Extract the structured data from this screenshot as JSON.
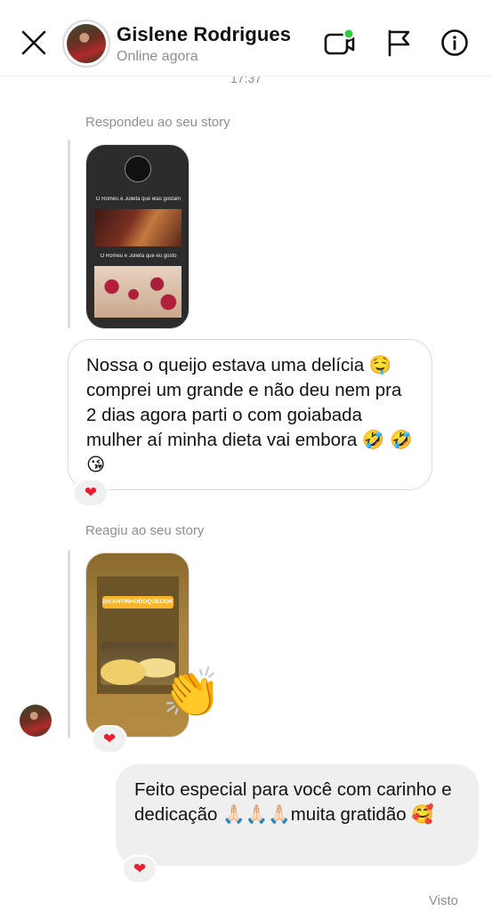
{
  "header": {
    "contact_name": "Gislene Rodrigues",
    "status": "Online agora",
    "close_icon": "close-icon",
    "video_icon": "video-call-icon",
    "flag_icon": "flag-icon",
    "info_icon": "info-icon",
    "online_dot_color": "#2ecc40"
  },
  "time_stamp": "17:37",
  "messages": [
    {
      "type": "story_reply",
      "label": "Respondeu ao seu story",
      "story": {
        "caption_1": "O Romeu e Julieta que elas gostam",
        "caption_2": "O Romeu e Julieta que eu gosto"
      },
      "text": "Nossa o queijo estava uma delícia 🤤 comprei um grande e não deu nem pra 2 dias agora parti o com goiabada mulher aí minha dieta vai embora 🤣 🤣😘",
      "reaction": "❤"
    },
    {
      "type": "story_reaction",
      "label": "Reagiu ao seu story",
      "story": {
        "handle": "@CANTINHODOQUEIJOKE"
      },
      "reaction_emoji": "👏",
      "reaction": "❤"
    },
    {
      "type": "outgoing",
      "text": "Feito especial para você com carinho e dedicação 🙏🏻🙏🏻🙏🏻muita gratidão 🥰",
      "reaction": "❤"
    }
  ],
  "seen_label": "Visto",
  "colors": {
    "reaction_heart": "#ed1b2f",
    "outgoing_bubble": "#efefef",
    "muted_text": "#8e8e8e"
  }
}
